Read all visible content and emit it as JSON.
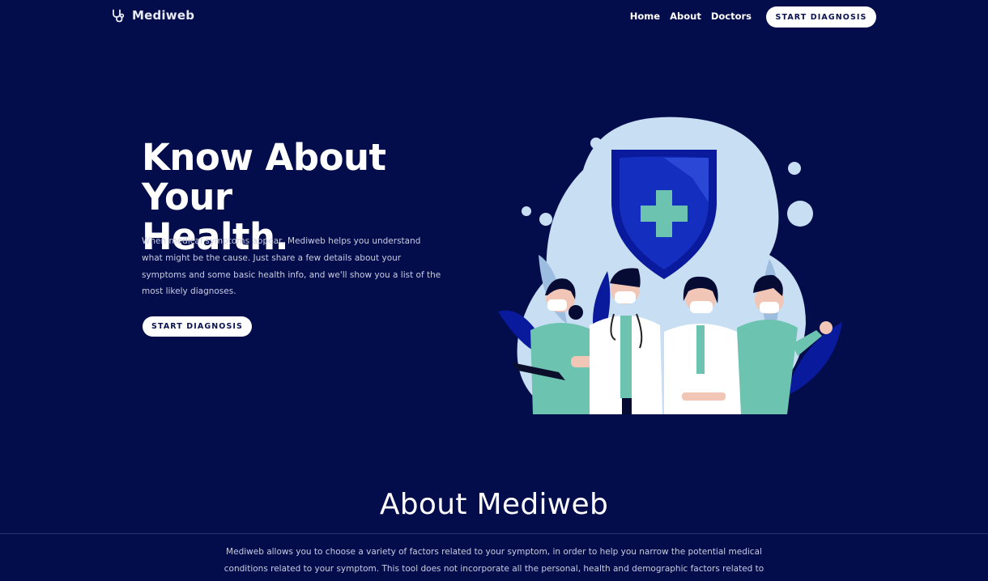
{
  "nav": {
    "brand": "Mediweb",
    "brand_icon": "stethoscope-icon",
    "links": [
      "Home",
      "About",
      "Doctors"
    ],
    "cta_label": "START DIAGNOSIS"
  },
  "hero": {
    "title_line1": "Know About Your",
    "title_line2": "Health.",
    "description": "When medical symptoms appear, Mediweb helps you understand what might be the cause. Just share a few details about your symptoms and some basic health info, and we'll show you a list of the most likely diagnoses.",
    "cta_label": "START DIAGNOSIS"
  },
  "about": {
    "title": "About Mediweb",
    "text": "Mediweb allows you to choose a variety of factors related to your symptom, in order to help you narrow the potential medical conditions related to your symptom. This tool does not incorporate all the personal, health and demographic factors related to you,"
  },
  "colors": {
    "background": "#040d4c",
    "button_bg": "#ffffff",
    "button_text": "#0a1250",
    "accent_teal": "#6cc4b0",
    "shield_blue": "#0a1a9c",
    "blob_light": "#c8def2"
  }
}
